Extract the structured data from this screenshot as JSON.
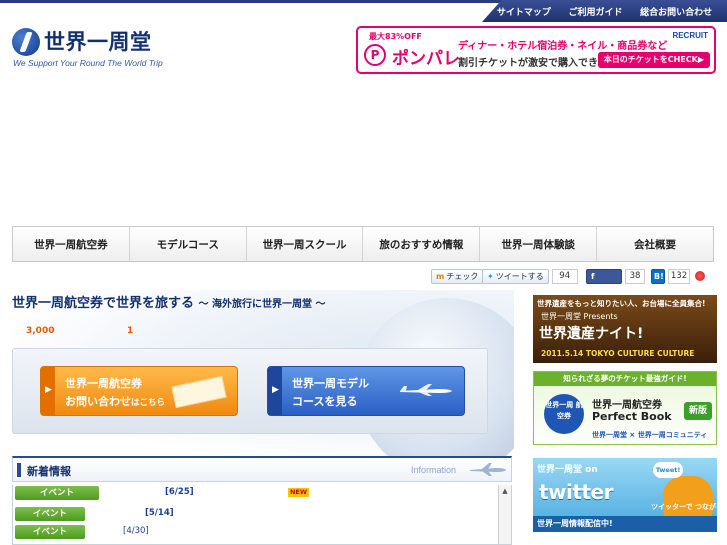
{
  "topnav": {
    "items": [
      "サイトマップ",
      "ご利用ガイド",
      "総合お問い合わせ"
    ]
  },
  "logo": {
    "text": "世界一周堂",
    "tagline": "We Support Your Round The World Trip"
  },
  "ad": {
    "sale": "最大83%OFF",
    "brand": "ポンパレ",
    "line1": "ディナー・ホテル宿泊券・ネイル・商品券など",
    "line2": "割引チケットが激安で購入できる！",
    "recruit": "RECRUIT",
    "cta": "本日のチケットをCHECK▶"
  },
  "mainnav": {
    "items": [
      "世界一周航空券",
      "モデルコース",
      "世界一周スクール",
      "旅のおすすめ情報",
      "世界一周体験談",
      "会社概要"
    ]
  },
  "social": {
    "check": "チェック",
    "tweet": "ツイートする",
    "tweet_count": "94",
    "fb_count": "38",
    "hatena_count": "132"
  },
  "hero": {
    "title": "世界一周航空券で世界を旅する",
    "subtitle": "～ 海外旅行に世界一周堂 ～",
    "num1": "3,000",
    "num2": "1",
    "cta1_line1": "世界一周航空券",
    "cta1_line2": "お問い合わせ",
    "cta1_suffix": "はこちら",
    "cta2_line1": "世界一周モデル",
    "cta2_line2": "コースを見る"
  },
  "news": {
    "title": "新着情報",
    "title_en": "Information",
    "rows": [
      {
        "category": "イベント",
        "date": "[6/25]",
        "new": "NEW"
      },
      {
        "category": "イベント",
        "date": "[5/14]",
        "new": ""
      },
      {
        "category": "イベント",
        "date": "[4/30]",
        "new": ""
      }
    ]
  },
  "sidebar": {
    "banner1": {
      "top": "世界遺産をもっと知りたい人、お台場に全員集合!",
      "presents": "世界一周堂 Presents",
      "main": "世界遺産ナイト!",
      "date": "2011.5.14  TOKYO CULTURE CULTURE"
    },
    "banner2": {
      "top": "知られざる夢のチケット最強ガイド!",
      "stamp": "世界一周 航空券",
      "line1": "世界一周航空券",
      "line2": "Perfect Book",
      "new": "新版",
      "foot": "世界一周堂 × 世界一周コミュニティ"
    },
    "banner3": {
      "head": "世界一周堂 on",
      "brand": "twitter",
      "bubble": "Tweet!",
      "follow": "ツイッターで つながろう!",
      "foot": "世界一周情報配信中!"
    }
  }
}
